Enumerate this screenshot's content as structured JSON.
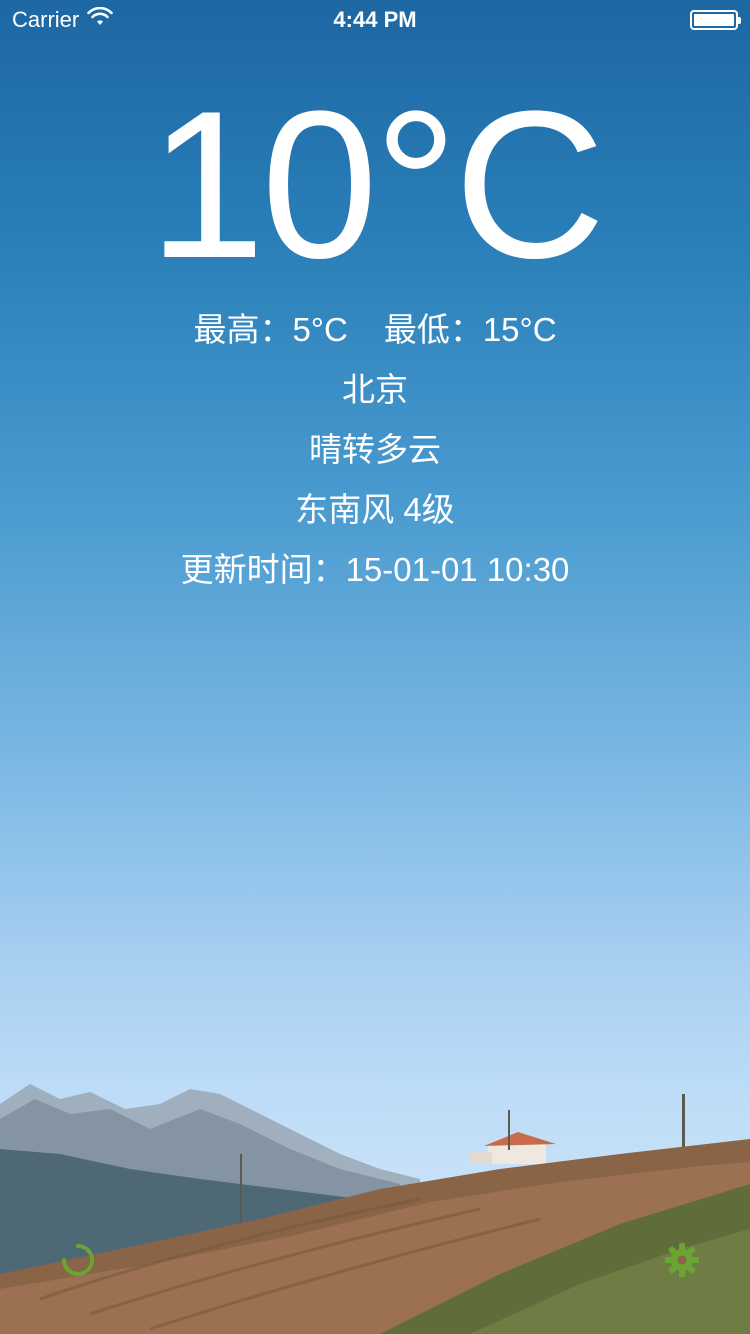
{
  "status_bar": {
    "carrier": "Carrier",
    "time": "4:44 PM"
  },
  "weather": {
    "temperature": "10°C",
    "high": "最高：5°C",
    "low": "最低：15°C",
    "city": "北京",
    "condition": "晴转多云",
    "wind": "东南风 4级",
    "updated": "更新时间：15-01-01 10:30"
  },
  "icons": {
    "refresh": "refresh-icon",
    "settings": "gear-icon",
    "wifi": "wifi-icon",
    "battery": "battery-icon"
  },
  "colors": {
    "accent": "#6aa531"
  }
}
